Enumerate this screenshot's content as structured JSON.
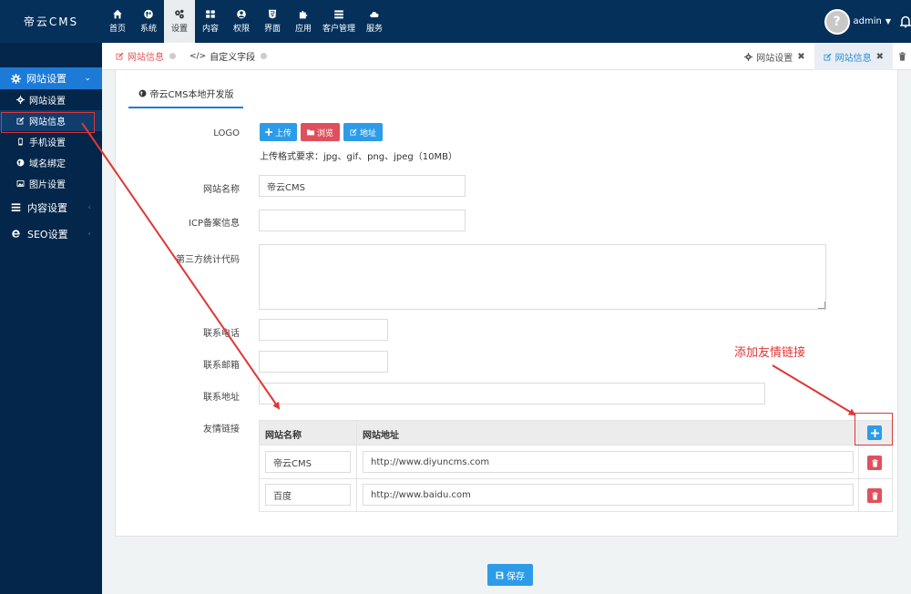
{
  "topbar": {
    "brand": "帝云CMS",
    "nav": [
      {
        "label": "首页",
        "icon": "home-icon"
      },
      {
        "label": "系统",
        "icon": "globe-icon"
      },
      {
        "label": "设置",
        "icon": "cogs-icon"
      },
      {
        "label": "内容",
        "icon": "grid-icon"
      },
      {
        "label": "权限",
        "icon": "user-circle-icon"
      },
      {
        "label": "界面",
        "icon": "html5-icon"
      },
      {
        "label": "应用",
        "icon": "puzzle-icon"
      },
      {
        "label": "客户管理",
        "icon": "list-icon"
      },
      {
        "label": "服务",
        "icon": "cloud-icon"
      }
    ],
    "user": "admin",
    "avatar_text": "?"
  },
  "sidebar": {
    "section": "网站设置",
    "items": [
      {
        "label": "网站设置",
        "icon": "gear-icon"
      },
      {
        "label": "网站信息",
        "icon": "edit-icon"
      },
      {
        "label": "手机设置",
        "icon": "mobile-icon"
      },
      {
        "label": "域名绑定",
        "icon": "globe-icon"
      },
      {
        "label": "图片设置",
        "icon": "image-icon"
      }
    ],
    "groups": [
      {
        "label": "内容设置",
        "icon": "list-icon"
      },
      {
        "label": "SEO设置",
        "icon": "ie-icon"
      }
    ]
  },
  "tabbar": {
    "page_tabs": [
      {
        "label": "网站信息"
      },
      {
        "label": "自定义字段"
      }
    ],
    "window_tabs": [
      {
        "label": "网站设置"
      },
      {
        "label": "网站信息"
      }
    ]
  },
  "panel": {
    "tab": "帝云CMS本地开发版"
  },
  "form": {
    "logo_label": "LOGO",
    "upload_btn": "上传",
    "browse_btn": "浏览",
    "address_btn": "地址",
    "upload_hint": "上传格式要求：jpg、gif、png、jpeg（10MB）",
    "site_name_label": "网站名称",
    "site_name_value": "帝云CMS",
    "icp_label": "ICP备案信息",
    "icp_value": "",
    "stats_label": "第三方统计代码",
    "stats_value": "",
    "phone_label": "联系电话",
    "email_label": "联系邮箱",
    "address_label": "联系地址",
    "links_label": "友情链接"
  },
  "links_table": {
    "col_name": "网站名称",
    "col_url": "网站地址",
    "rows": [
      {
        "name": "帝云CMS",
        "url": "http://www.diyuncms.com"
      },
      {
        "name": "百度",
        "url": "http://www.baidu.com"
      }
    ]
  },
  "annotation": {
    "text": "添加友情链接",
    "color": "#e03636"
  },
  "save_btn": "保存",
  "colors": {
    "topbar": "#04305a",
    "sidebar": "#03264a",
    "accent": "#2d9ce8",
    "danger": "#e0505c"
  }
}
